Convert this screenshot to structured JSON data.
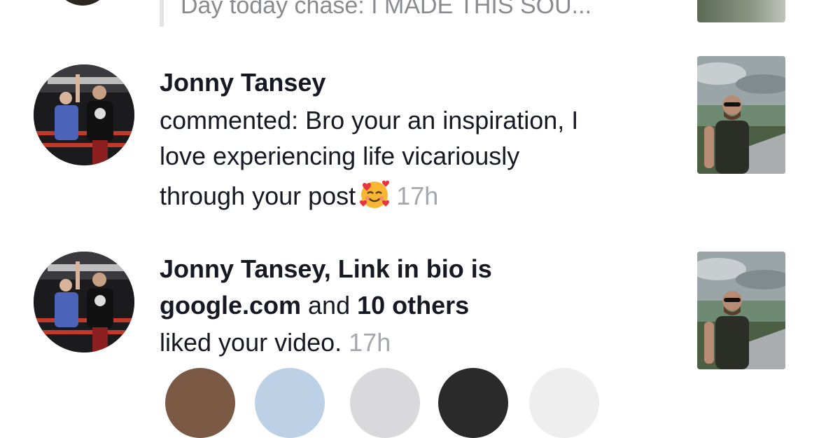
{
  "top_item": {
    "preview_text": "Day today chase: I MADE THIS SOU..."
  },
  "notifications": [
    {
      "name": "Jonny Tansey",
      "line1": "commented: Bro your an inspiration, I",
      "line2": "love experiencing life vicariously",
      "line3": "through your post",
      "emoji": "smiling-face-with-hearts",
      "time": "17h"
    },
    {
      "name_part1": "Jonny Tansey, Link in bio is",
      "name_part2": "google.com",
      "connector": "and",
      "others": "10 others",
      "action": "liked your video.",
      "time": "17h"
    }
  ],
  "colors": {
    "text": "#161823",
    "muted": "#a5a7ae",
    "quote": "#8a8b91",
    "background": "#ffffff"
  }
}
